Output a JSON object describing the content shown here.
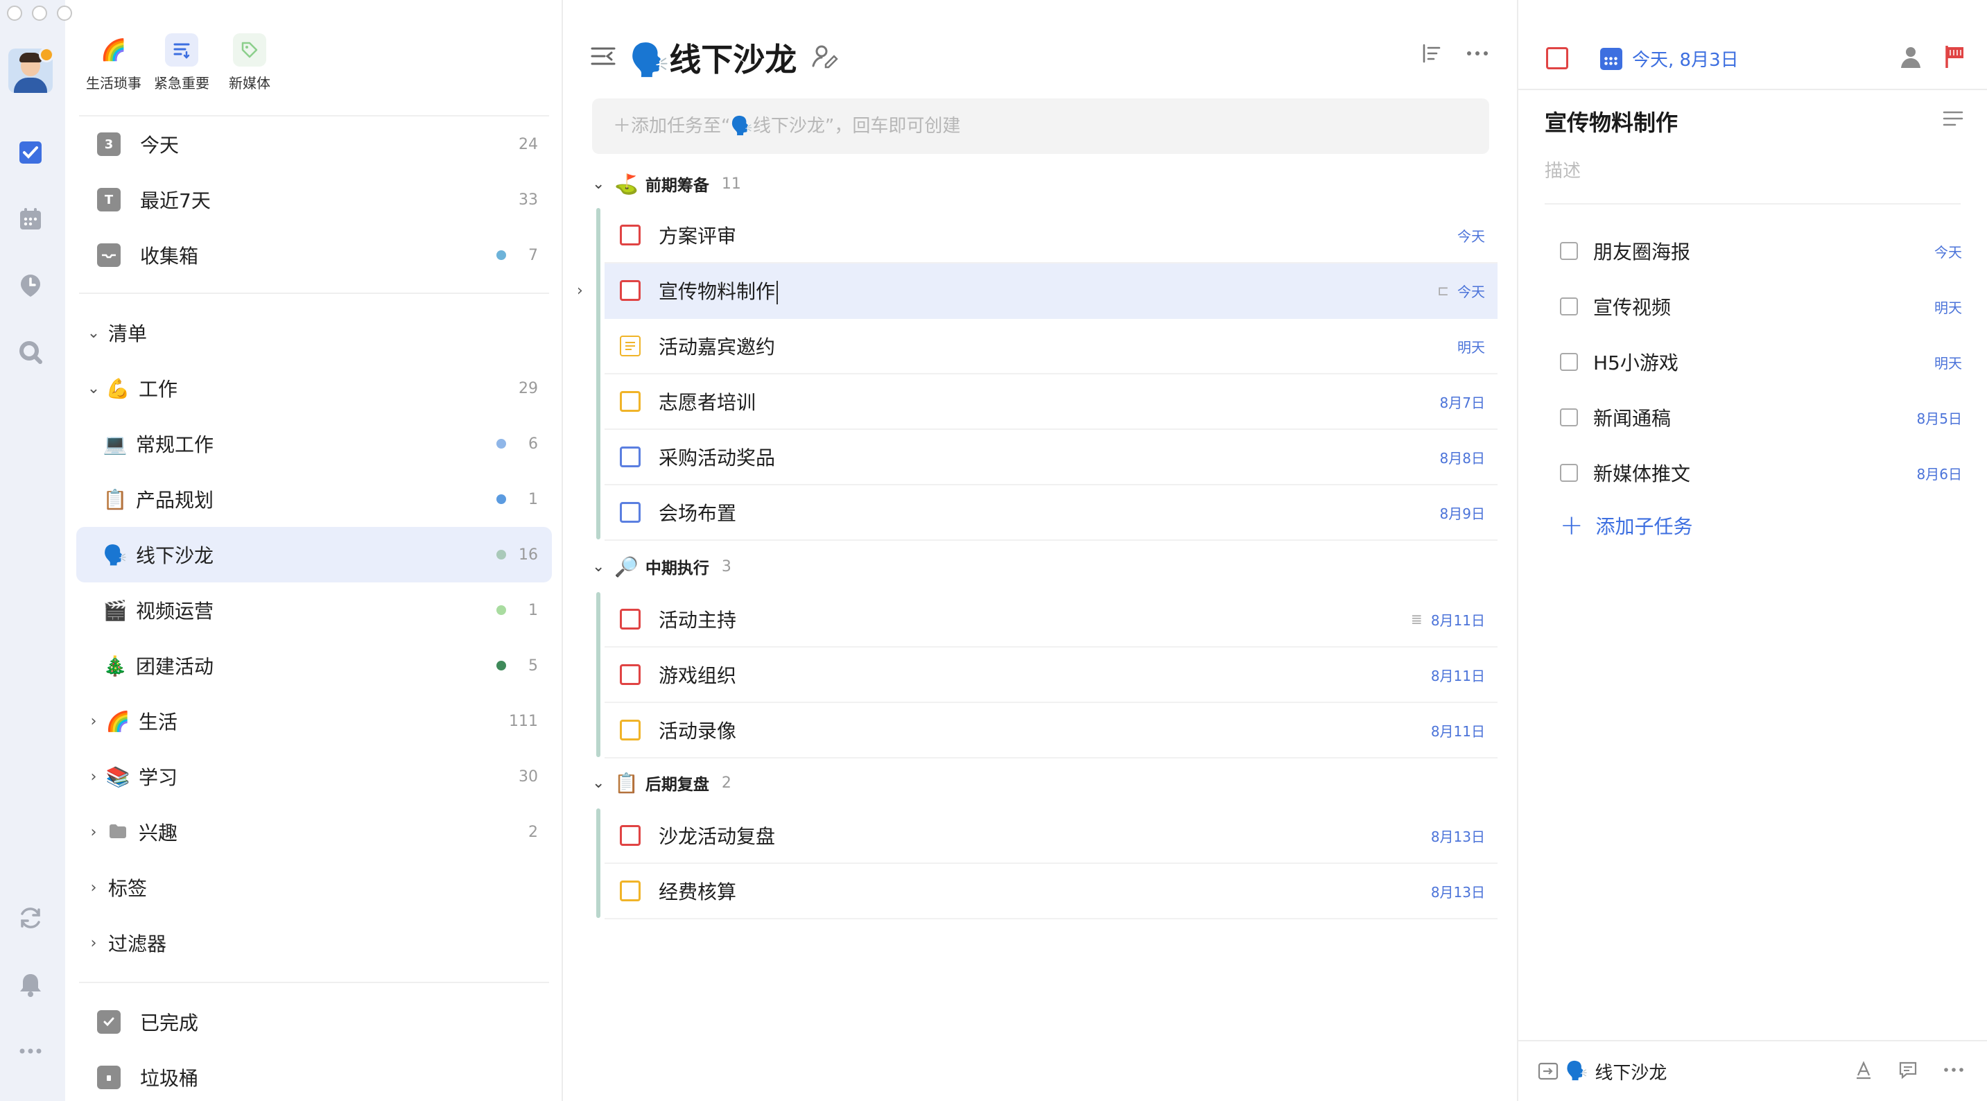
{
  "quick_filters": [
    {
      "label": "生活琐事",
      "icon": "🌈"
    },
    {
      "label": "紧急重要",
      "icon": "filter-icon"
    },
    {
      "label": "新媒体",
      "icon": "tag-icon"
    }
  ],
  "smart_lists": [
    {
      "label": "今天",
      "count": "24",
      "icon_text": "3"
    },
    {
      "label": "最近7天",
      "count": "33",
      "icon_text": "T"
    },
    {
      "label": "收集箱",
      "count": "7",
      "dot": "#6db3d9"
    }
  ],
  "lists_header": "清单",
  "folders": {
    "work": {
      "label": "工作",
      "emoji": "💪",
      "count": "29"
    },
    "work_items": [
      {
        "label": "常规工作",
        "emoji": "💻",
        "count": "6",
        "dot": "#8fb6e8"
      },
      {
        "label": "产品规划",
        "emoji": "📋",
        "count": "1",
        "dot": "#5b9be0"
      },
      {
        "label": "线下沙龙",
        "emoji": "🗣️",
        "count": "16",
        "dot": "#a9c9b9"
      },
      {
        "label": "视频运营",
        "emoji": "🎬",
        "count": "1",
        "dot": "#a9dca0"
      },
      {
        "label": "团建活动",
        "emoji": "🎄",
        "count": "5",
        "dot": "#3f8a5a"
      }
    ],
    "others": [
      {
        "label": "生活",
        "emoji": "🌈",
        "count": "111"
      },
      {
        "label": "学习",
        "emoji": "📚",
        "count": "30"
      },
      {
        "label": "兴趣",
        "emoji": "folder",
        "count": "2"
      }
    ]
  },
  "tags_label": "标签",
  "filters_label": "过滤器",
  "completed_label": "已完成",
  "trash_label": "垃圾桶",
  "main": {
    "title_emoji": "🗣️",
    "title": "线下沙龙",
    "add_placeholder": "＋添加任务至“🗣️线下沙龙”，回车即可创建",
    "sections": [
      {
        "name": "前期筹备",
        "emoji": "⛳",
        "count": "11",
        "tasks": [
          {
            "title": "方案评审",
            "due": "今天",
            "color": "#e04444"
          },
          {
            "title": "宣传物料制作",
            "due": "今天",
            "color": "#e04444",
            "active": true
          },
          {
            "title": "活动嘉宾邀约",
            "due": "明天",
            "color": "#f0b429",
            "note": true
          },
          {
            "title": "志愿者培训",
            "due": "8月7日",
            "color": "#f0b429"
          },
          {
            "title": "采购活动奖品",
            "due": "8月8日",
            "color": "#5b7fe0"
          },
          {
            "title": "会场布置",
            "due": "8月9日",
            "color": "#5b7fe0"
          }
        ]
      },
      {
        "name": "中期执行",
        "emoji": "🔎",
        "count": "3",
        "tasks": [
          {
            "title": "活动主持",
            "due": "8月11日",
            "color": "#e04444"
          },
          {
            "title": "游戏组织",
            "due": "8月11日",
            "color": "#e04444"
          },
          {
            "title": "活动录像",
            "due": "8月11日",
            "color": "#f0b429"
          }
        ]
      },
      {
        "name": "后期复盘",
        "emoji": "📋",
        "count": "2",
        "tasks": [
          {
            "title": "沙龙活动复盘",
            "due": "8月13日",
            "color": "#e04444"
          },
          {
            "title": "经费核算",
            "due": "8月13日",
            "color": "#f0b429"
          }
        ]
      }
    ]
  },
  "detail": {
    "date": "今天, 8月3日",
    "title": "宣传物料制作",
    "description_placeholder": "描述",
    "subtasks": [
      {
        "title": "朋友圈海报",
        "due": "今天"
      },
      {
        "title": "宣传视频",
        "due": "明天"
      },
      {
        "title": "H5小游戏",
        "due": "明天"
      },
      {
        "title": "新闻通稿",
        "due": "8月5日"
      },
      {
        "title": "新媒体推文",
        "due": "8月6日"
      }
    ],
    "add_subtask": "添加子任务",
    "footer_list": "线下沙龙",
    "footer_emoji": "🗣️"
  },
  "colors": {
    "accent": "#3d6fe0",
    "priority_high": "#e04444",
    "priority_medium": "#f0b429",
    "priority_low": "#5b7fe0"
  }
}
